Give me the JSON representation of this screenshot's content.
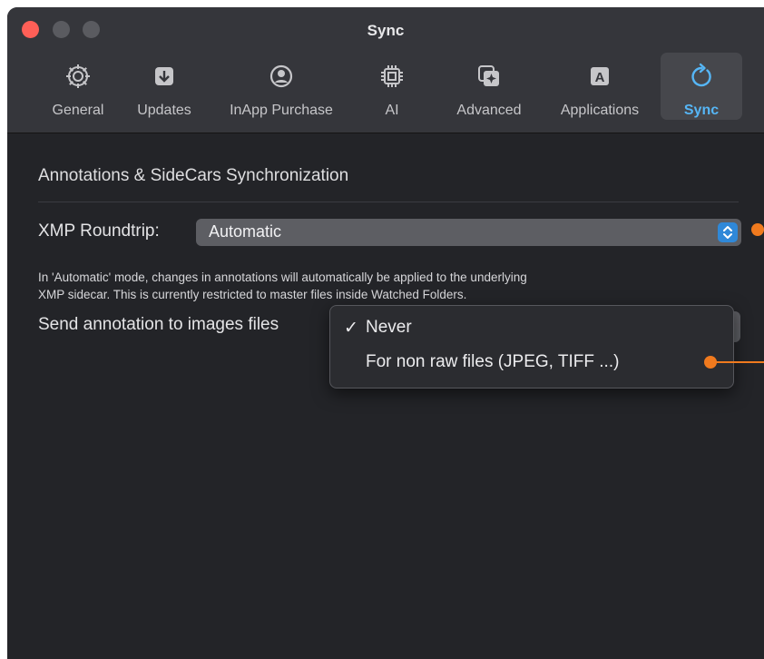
{
  "window": {
    "title": "Sync",
    "traffic_lights": [
      "close",
      "minimize",
      "zoom"
    ]
  },
  "toolbar": {
    "tabs": [
      {
        "label": "General",
        "icon": "gear-icon"
      },
      {
        "label": "Updates",
        "icon": "download-arrow-icon"
      },
      {
        "label": "InApp Purchase",
        "icon": "user-circle-icon"
      },
      {
        "label": "AI",
        "icon": "cpu-chip-icon"
      },
      {
        "label": "Advanced",
        "icon": "sparkle-window-icon"
      },
      {
        "label": "Applications",
        "icon": "letter-a-icon"
      },
      {
        "label": "Sync",
        "icon": "refresh-arrow-icon",
        "active": true
      }
    ]
  },
  "sync": {
    "section_title": "Annotations & SideCars Synchronization",
    "xmp_label": "XMP Roundtrip:",
    "xmp_value": "Automatic",
    "help_line1": "In 'Automatic' mode, changes in annotations will automatically be applied to the underlying",
    "help_line2": "XMP sidecar. This is currently restricted to master files inside Watched Folders.",
    "send_label": "Send annotation to images files"
  },
  "menu": {
    "check": "✓",
    "options": [
      {
        "label": "Never",
        "checked": true
      },
      {
        "label": "For non raw files (JPEG, TIFF ...)",
        "checked": false
      }
    ]
  },
  "colors": {
    "accent": "#56b6f6",
    "window_bg": "#232428",
    "toolbar_bg": "#35363b",
    "popup_bg": "#5d5e63",
    "stepper": "#2f88d8",
    "annotation_marker": "#f07a1e",
    "close_button": "#ff5f57"
  }
}
